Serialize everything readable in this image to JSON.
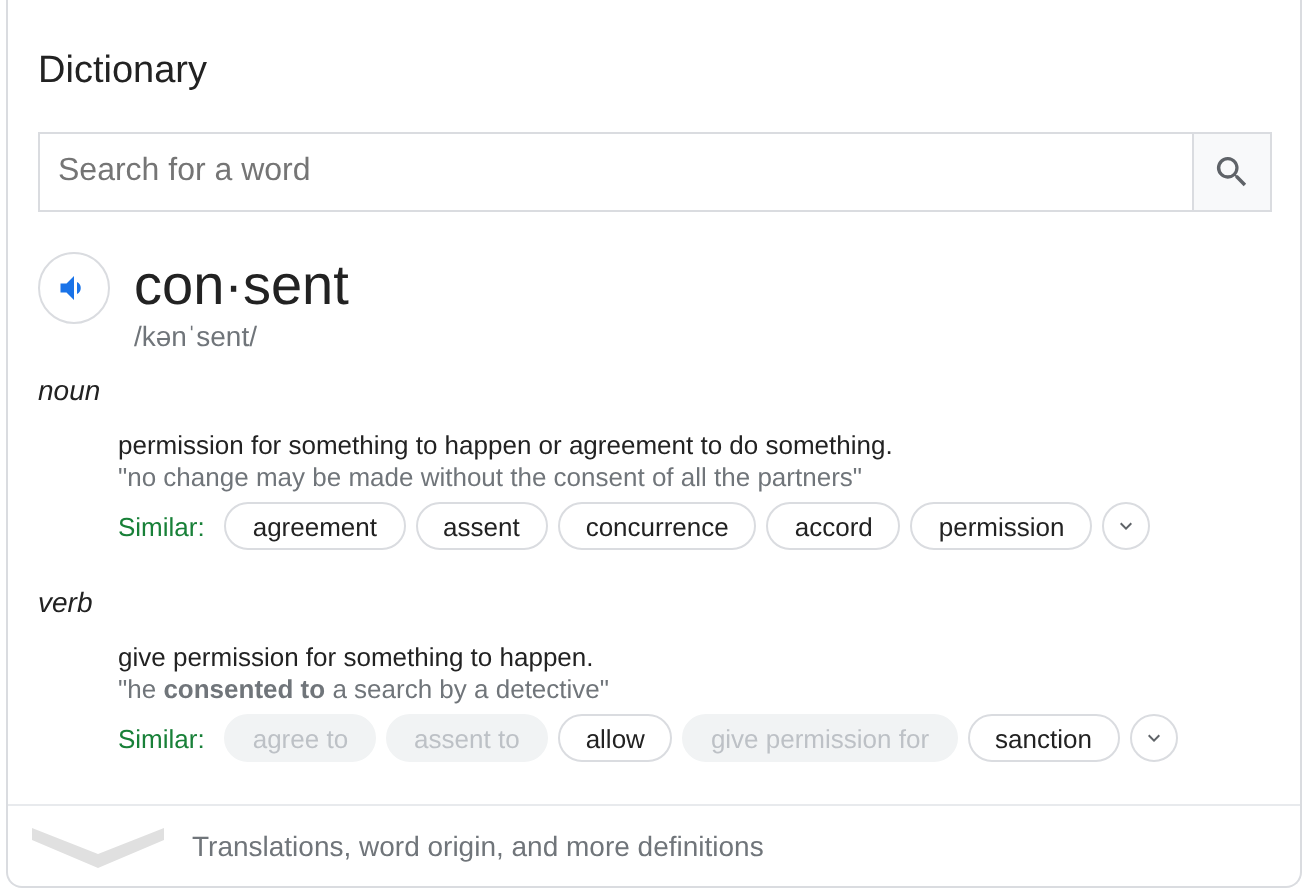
{
  "title": "Dictionary",
  "search": {
    "placeholder": "Search for a word"
  },
  "entry": {
    "word": "con·sent",
    "phonetic": "/kənˈsent/"
  },
  "senses": [
    {
      "part_of_speech": "noun",
      "definition": "permission for something to happen or agreement to do something.",
      "example": "\"no change may be made without the consent of all the partners\"",
      "similar_label": "Similar:",
      "similar": [
        {
          "word": "agreement",
          "disabled": false
        },
        {
          "word": "assent",
          "disabled": false
        },
        {
          "word": "concurrence",
          "disabled": false
        },
        {
          "word": "accord",
          "disabled": false
        },
        {
          "word": "permission",
          "disabled": false
        }
      ]
    },
    {
      "part_of_speech": "verb",
      "definition": "give permission for something to happen.",
      "example": "\"he **consented to** a search by a detective\"",
      "similar_label": "Similar:",
      "similar": [
        {
          "word": "agree to",
          "disabled": true
        },
        {
          "word": "assent to",
          "disabled": true
        },
        {
          "word": "allow",
          "disabled": false
        },
        {
          "word": "give permission for",
          "disabled": true
        },
        {
          "word": "sanction",
          "disabled": false
        }
      ]
    }
  ],
  "footer": {
    "label": "Translations, word origin, and more definitions"
  }
}
